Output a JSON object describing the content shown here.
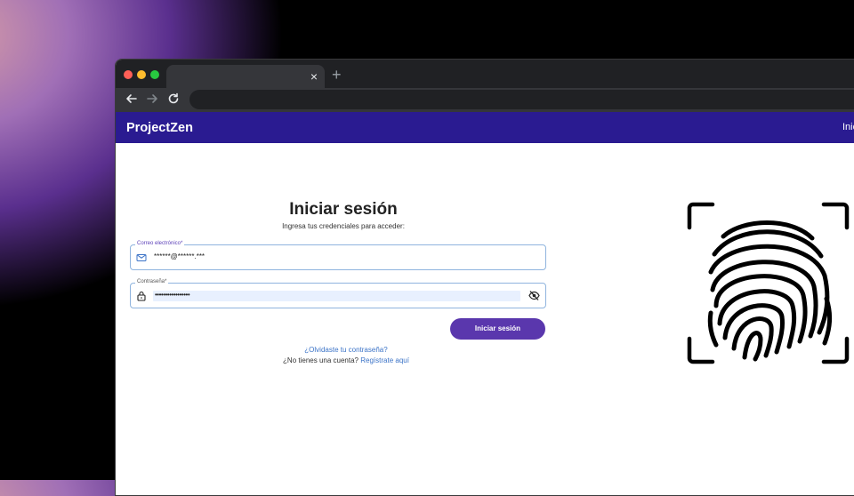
{
  "browser": {
    "tab_close": "×",
    "new_tab": "+"
  },
  "app": {
    "brand": "ProjectZen",
    "nav_link": "Inic"
  },
  "login": {
    "title": "Iniciar sesión",
    "subtitle": "Ingresa tus credenciales para acceder:",
    "email_label": "Correo electrónico*",
    "email_value": "******@******.***",
    "password_label": "Contraseña*",
    "password_value": "•••••••••••••••••",
    "submit_label": "Iniciar sesión",
    "forgot_link": "¿Olvidaste tu contraseña?",
    "no_account_text": "¿No tienes una cuenta?",
    "register_link": "Regístrate aquí"
  },
  "icons": {
    "back": "back-arrow-icon",
    "forward": "forward-arrow-icon",
    "reload": "reload-icon",
    "email": "mail-icon",
    "password": "lock-icon",
    "toggle_visibility": "eye-off-icon",
    "illustration": "fingerprint-icon"
  },
  "colors": {
    "header": "#2a1b91",
    "primary_button": "#5a37ad",
    "link": "#3b73c7",
    "field_border": "#8fb4de"
  }
}
